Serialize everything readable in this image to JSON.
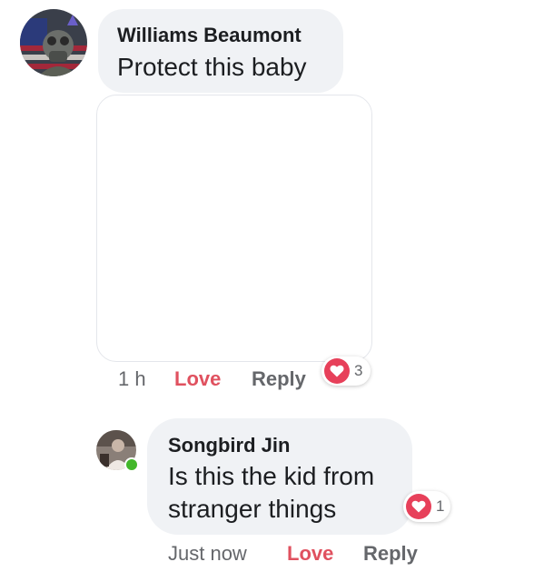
{
  "comments": [
    {
      "author": "Williams Beaumont",
      "text": "Protect this baby",
      "timestamp": "1 h",
      "love_label": "Love",
      "reply_label": "Reply",
      "reaction_count": "3",
      "reaction_icon": "heart-icon",
      "has_image_attachment": true
    },
    {
      "author": "Songbird Jin",
      "text": "Is this the kid from stranger things",
      "timestamp": "Just now",
      "love_label": "Love",
      "reply_label": "Reply",
      "reaction_count": "1",
      "reaction_icon": "heart-icon",
      "online": true
    }
  ],
  "colors": {
    "bubble_bg": "#f0f2f5",
    "love_accent": "#e0515f",
    "heart_badge": "#e7405a",
    "secondary_text": "#65676b",
    "online_green": "#42b72a"
  }
}
